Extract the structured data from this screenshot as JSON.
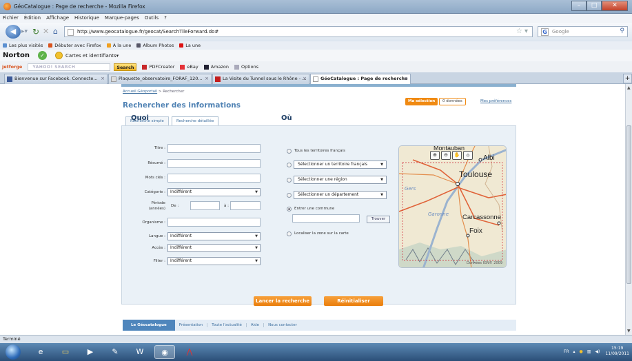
{
  "window": {
    "title": "GéoCatalogue : Page de recherche - Mozilla Firefox"
  },
  "menu": [
    "Fichier",
    "Édition",
    "Affichage",
    "Historique",
    "Marque-pages",
    "Outils",
    "?"
  ],
  "nav": {
    "url": "http://www.geocatalogue.fr/geocat/SearchTileForward.do#",
    "search_placeholder": "Google"
  },
  "bookmarks": [
    "Les plus visités",
    "Débuter avec Firefox",
    "À la une",
    "Album Photos",
    "La une"
  ],
  "norton": {
    "logo": "Norton",
    "identity": "Cartes et identifiants"
  },
  "toolbar2": {
    "jf": "jetforge",
    "ysearch": "YAHOO! SEARCH",
    "search_btn": "Search",
    "pdf": "PDFCreator",
    "ebay": "eBay",
    "amazon": "Amazon",
    "options": "Options"
  },
  "tabs": [
    {
      "label": "Bienvenue sur Facebook. Connecte...",
      "color": "#3b5998"
    },
    {
      "label": "Plaquette_observatoire_FORAF_120...",
      "color": "#cccccc"
    },
    {
      "label": "La Visite du Tunnel sous le Rhône - ...",
      "color": "#c41e1e"
    },
    {
      "label": "GéoCatalogue : Page de recherche",
      "color": "#ffffff"
    }
  ],
  "page": {
    "breadcrumb_link": "Accueil Géoportail",
    "breadcrumb_current": "Rechercher",
    "title": "Rechercher des informations",
    "selection_label": "Ma sélection",
    "selection_count": "0 données",
    "preferences": "Mes préférences",
    "search_tabs": [
      "Recherche simple",
      "Recherche détaillée"
    ]
  },
  "quoi": {
    "heading": "Quoi",
    "titre": "Titre :",
    "resume": "Résumé :",
    "mots_cles": "Mots clés :",
    "categorie": "Catégorie :",
    "categorie_value": "Indifférent",
    "periode": "Période",
    "annees": "(années)",
    "de": "De :",
    "a": "à :",
    "organisme": "Organisme :",
    "langue": "Langue :",
    "langue_value": "Indifférent",
    "acces": "Accès :",
    "acces_value": "Indifférent",
    "filter": "Filter :",
    "filter_value": "Indifférent"
  },
  "ou": {
    "heading": "Où",
    "tous": "Tous les territoires français",
    "territoire": "Sélectionner un territoire français",
    "region": "Sélectionner une région",
    "departement": "Sélectionner un département",
    "commune": "Entrer une commune",
    "trouver": "Trouver",
    "localiser": "Localiser la zone sur la carte",
    "map_credit": "Données IGN© 2009",
    "map_places": [
      "Montauban",
      "Albi",
      "Toulouse",
      "Gers",
      "Garonne",
      "Carcassonne",
      "Foix"
    ]
  },
  "actions": {
    "launch": "Lancer la recherche",
    "reset": "Réinitialiser"
  },
  "footer_nav": [
    "Le Géocatalogue",
    "Présentation",
    "Toute l'actualité",
    "Aide",
    "Nous contacter"
  ],
  "status": "Terminé",
  "taskbar": {
    "lang": "FR",
    "time": "15:19",
    "date": "11/09/2011"
  },
  "colors": {
    "accent": "#f08a12",
    "link": "#3c6e9e",
    "title": "#5183b4"
  }
}
